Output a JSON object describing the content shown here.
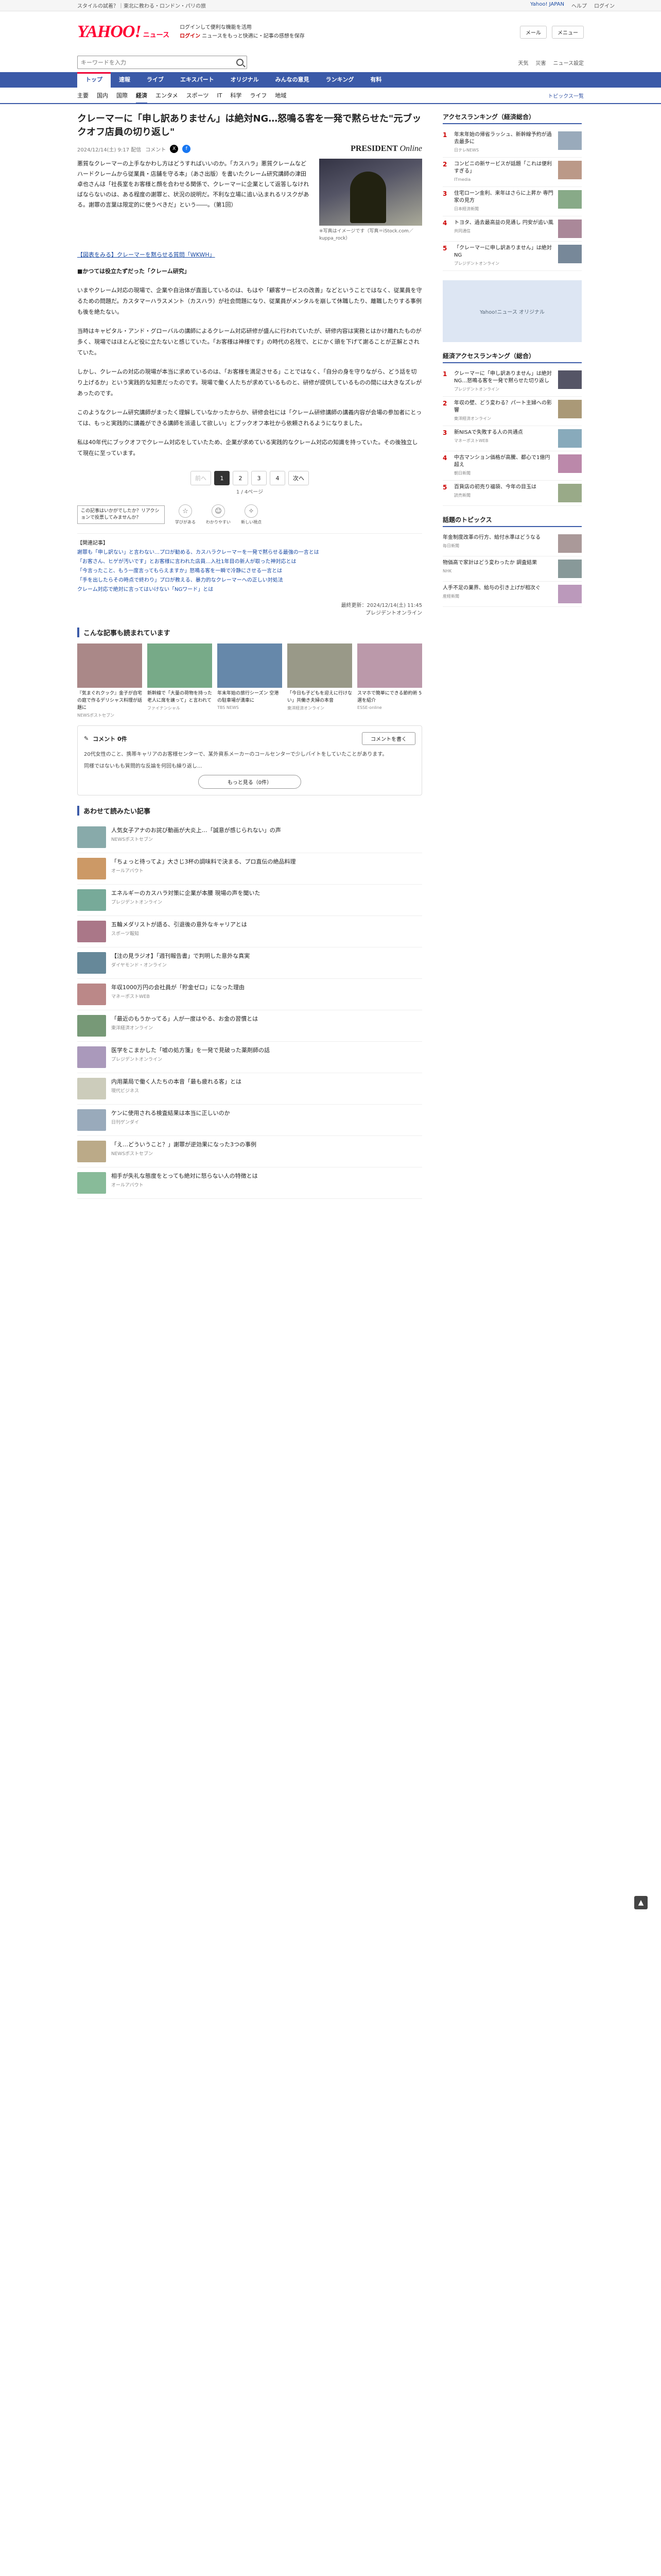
{
  "util": {
    "left": "スタイルの試着？｜東北に教わる・ロンドン・パリの旅",
    "links": [
      "Yahoo! JAPAN",
      "ヘルプ",
      "ログイン"
    ]
  },
  "masthead": {
    "logo": "YAHOO!",
    "logo_sub": "ニュース",
    "info_1": "ログインして便利な機能を活用",
    "info_2": "ニュースをもっと快適に・記事の感想を保存",
    "notice": "ログイン",
    "btn_mail": "メール",
    "btn_menu": "メニュー"
  },
  "search": {
    "placeholder": "キーワードを入力",
    "right": [
      "天気",
      "災害",
      "ニュース設定"
    ]
  },
  "nav": [
    "トップ",
    "速報",
    "ライブ",
    "エキスパート",
    "オリジナル",
    "みんなの意見",
    "ランキング",
    "有料"
  ],
  "subnav": {
    "items": [
      "主要",
      "国内",
      "国際",
      "経済",
      "エンタメ",
      "スポーツ",
      "IT",
      "科学",
      "ライフ",
      "地域"
    ],
    "right": "トピックス一覧"
  },
  "article": {
    "headline": "クレーマーに「申し訳ありません」は絶対NG…怒鳴る客を一発で黙らせた\"元ブックオフ店員の切り返し\"",
    "date": "2024/12/14(土) 9:17 配信",
    "comment_count": "コメント",
    "source": "PRESIDENT",
    "source_em": "Online",
    "lead": "悪質なクレーマーの上手なかわし方はどうすればいいのか。「カスハラ」悪質クレームなど　ハードクレームから従業員・店舗を守る本」（あさ出版）を書いたクレーム研究講師の津田卓也さんは「社長室をお客様と顔を合わせる関係で、クレーマーに企業として返答しなければならないのは、ある程度の謝罪と、状況の説明だ。不利な立場に追い込まれるリスクがある。謝罪の言葉は限定的に使うべきだ」という――。（第1回）",
    "photo_caption": "※写真はイメージです（写真＝iStock.com／kuppa_rock）",
    "link_label": "【図表をみる】クレーマーを黙らせる質問「WKWH」",
    "subhead": "■かつては役立たずだった「クレーム研究」",
    "paras": [
      "いまやクレーム対応の現場で、企業や自治体が直面しているのは、もはや「顧客サービスの改善」などということではなく、従業員を守るための問題だ。カスタマーハラスメント（カスハラ）が社会問題になり、従業員がメンタルを崩して休職したり、離職したりする事例も後を絶たない。",
      "当時はキャピタル・アンド・グローバルの講師によるクレーム対応研修が盛んに行われていたが、研修内容は実務とはかけ離れたものが多く、現場ではほとんど役に立たないと感じていた。「お客様は神様です」の時代の名残で、とにかく頭を下げて謝ることが正解とされていた。",
      "しかし、クレームの対応の現場が本当に求めているのは、「お客様を満足させる」ことではなく、「自分の身を守りながら、どう話を切り上げるか」という実践的な知恵だったのです。現場で働く人たちが求めているものと、研修が提供しているものの間には大きなズレがあったのです。",
      "このようなクレーム研究講師がまったく理解していなかったからか、研修会社には「クレーム研修講師の講義内容が会場の参加者にとっては、もっと実践的に講義ができる講師を派遣して欲しい」とブックオフ本社から依頼されるようになりました。",
      "私は40年代にブックオフでクレーム対応をしていたため、企業が求めている実践的なクレーム対応の知識を持っていた。その後独立して現在に至っています。"
    ]
  },
  "pager": {
    "prev": "前へ",
    "pages": [
      "1",
      "2",
      "3",
      "4"
    ],
    "next": "次へ",
    "count": "1 / 4ページ"
  },
  "reactions": {
    "tip": "この記事はいかがでしたか？リアクションで投票してみませんか？",
    "items": [
      {
        "label": "学びがある",
        "icon": "☆"
      },
      {
        "label": "わかりやすい",
        "icon": "☺"
      },
      {
        "label": "新しい視点",
        "icon": "✧"
      }
    ]
  },
  "footnote": {
    "heading": "【関連記事】",
    "lines": [
      "謝罪も「申し訳ない」と言わない…プロが勧める、カスハラクレーマーを一発で黙らせる最強の一言とは",
      "「お客さん、ヒゲが汚いです」とお客様に言われた店員…入社1年目の新人が取った神対応とは",
      "「今言ったこと、もう一度言ってもらえますか」怒鳴る客を一瞬で冷静にさせる一言とは",
      "「手を出したらその時点で終わり」プロが教える、暴力的なクレーマーへの正しい対処法",
      "クレーム対応で絶対に言ってはいけない「NGワード」とは"
    ],
    "updated": "最終更新：2024/12/14(土) 11:45",
    "byline": "プレジデントオンライン"
  },
  "recommend": {
    "title": "こんな記事も読まれています",
    "cards": [
      {
        "title": "『気まぐれクック』金子が自宅の庭で作るデリシャス料理が話題に",
        "src": "NEWSポストセブン"
      },
      {
        "title": "新幹線で「大量の荷物を持った老人に席を譲って」と言われて",
        "src": "ファイナンシャル"
      },
      {
        "title": "年末年始の旅行シーズン 空港の駐車場が満車に",
        "src": "TBS NEWS"
      },
      {
        "title": "「今日も子どもを迎えに行けない」共働き夫婦の本音",
        "src": "東洋経済オンライン"
      },
      {
        "title": "スマホで簡単にできる節約術 5選を紹介",
        "src": "ESSE-online"
      }
    ]
  },
  "comments": {
    "title": "コメント 0件",
    "button": "コメントを書く",
    "line1": "20代女性のこと、携帯キャリアのお客様センターで、某外資系メーカーのコールセンターで少しバイトをしていたことがあります。",
    "line2": "同様ではないもも質問的な反論を何回も繰り返し...",
    "more": "もっと見る（0件）"
  },
  "also_read": {
    "title": "あわせて読みたい記事",
    "items": [
      {
        "title": "人気女子アナのお詫び動画が大炎上…「誠意が感じられない」の声",
        "src": "NEWSポストセブン"
      },
      {
        "title": "「ちょっと待ってよ」大さじ3杯の調味料で決まる、プロ直伝の絶品料理",
        "src": "オールアバウト"
      },
      {
        "title": "エネルギーのカスハラ対策に企業が本腰 現場の声を聞いた",
        "src": "プレジデントオンライン"
      },
      {
        "title": "五輪メダリストが語る、引退後の意外なキャリアとは",
        "src": "スポーツ報知"
      },
      {
        "title": "【注の見ラジオ】「週刊報告書」で判明した意外な真実",
        "src": "ダイヤモンド・オンライン"
      },
      {
        "title": "年収1000万円の会社員が「貯金ゼロ」になった理由",
        "src": "マネーポストWEB"
      },
      {
        "title": "「最近のもうかってる」人が一度はやる、お金の習慣とは",
        "src": "東洋経済オンライン"
      },
      {
        "title": "医学をこまかした「嘘の処方箋」を一発で見破った薬剤師の話",
        "src": "プレジデントオンライン"
      },
      {
        "title": "内用薬局で働く人たちの本音「最も疲れる客」とは",
        "src": "現代ビジネス"
      },
      {
        "title": "ケンに使用される検査結果は本当に正しいのか",
        "src": "日刊ゲンダイ"
      },
      {
        "title": "「え…どういうこと？」謝罪が逆効果になった3つの事例",
        "src": "NEWSポストセブン"
      },
      {
        "title": "相手が失礼な態度をとっても絶対に怒らない人の特徴とは",
        "src": "オールアバウト"
      }
    ]
  },
  "side": {
    "access_title": "アクセスランキング（経済総合）",
    "access": [
      {
        "title": "年末年始の帰省ラッシュ、新幹線予約が過去最多に",
        "src": "日テレNEWS"
      },
      {
        "title": "コンビニの新サービスが話題「これは便利すぎる」",
        "src": "ITmedia"
      },
      {
        "title": "住宅ローン金利、来年はさらに上昇か 専門家の見方",
        "src": "日本経済新聞"
      },
      {
        "title": "トヨタ、過去最高益の見通し 円安が追い風",
        "src": "共同通信"
      },
      {
        "title": "「クレーマーに申し訳ありません」は絶対NG",
        "src": "プレジデントオンライン"
      }
    ],
    "ad": "Yahoo!ニュース オリジナル",
    "summary_title": "経済アクセスランキング（総合）",
    "summary": [
      {
        "title": "クレーマーに「申し訳ありません」は絶対NG…怒鳴る客を一発で黙らせた切り返し",
        "src": "プレジデントオンライン"
      },
      {
        "title": "年収の壁、どう変わる？パート主婦への影響",
        "src": "東洋経済オンライン"
      },
      {
        "title": "新NISAで失敗する人の共通点",
        "src": "マネーポストWEB"
      },
      {
        "title": "中古マンション価格が高騰、都心で1億円超え",
        "src": "朝日新聞"
      },
      {
        "title": "百貨店の初売り福袋、今年の目玉は",
        "src": "読売新聞"
      }
    ],
    "topics_title": "話題のトピックス",
    "topics": [
      {
        "title": "年金制度改革の行方、給付水準はどうなる",
        "src": "毎日新聞"
      },
      {
        "title": "物価高で家計はどう変わったか 調査結果",
        "src": "NHK"
      },
      {
        "title": "人手不足の業界、給与の引き上げが相次ぐ",
        "src": "産経新聞"
      }
    ]
  }
}
